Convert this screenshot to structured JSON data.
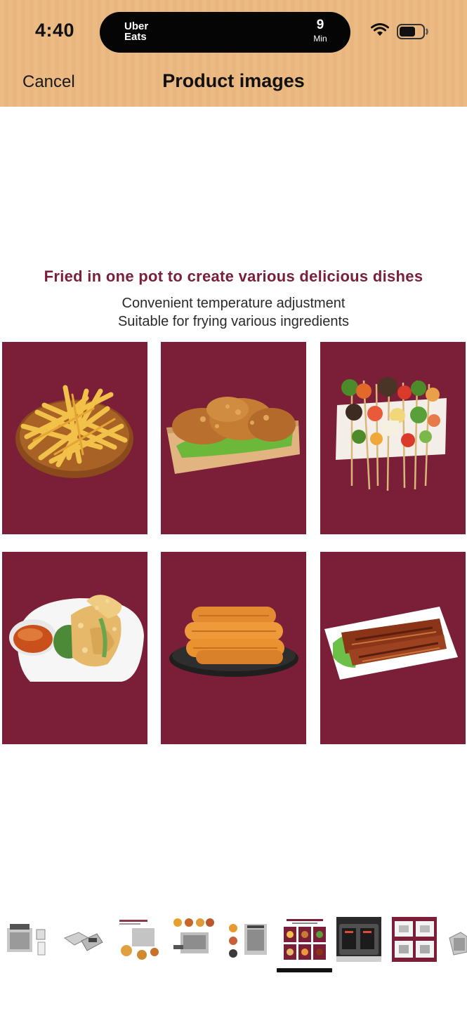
{
  "status_bar": {
    "time": "4:40",
    "live_activity": {
      "brand_line1": "Uber",
      "brand_line2": "Eats",
      "minutes": "9",
      "minutes_unit": "Min"
    }
  },
  "nav": {
    "cancel_label": "Cancel",
    "title": "Product images"
  },
  "product_image": {
    "headline": "Fried in one pot to create various delicious dishes",
    "subline1": "Convenient temperature adjustment",
    "subline2": "Suitable for frying various ingredients",
    "tiles": [
      "french-fries",
      "fried-chicken",
      "vegetable-skewers",
      "tempura",
      "fried-dough-sticks",
      "grilled-pork-belly"
    ]
  },
  "thumbnails": {
    "count": 9,
    "selected_index": 6
  },
  "colors": {
    "header_bg": "#ecbb84",
    "tile_bg": "#7b1e38",
    "headline": "#7a1f3a"
  }
}
